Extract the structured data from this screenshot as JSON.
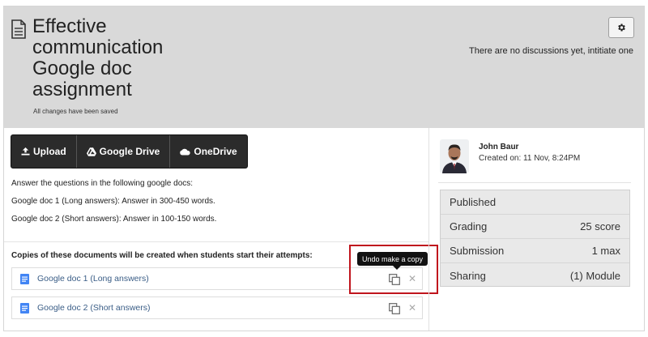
{
  "header": {
    "title": "Effective communication Google doc assignment",
    "saved_status": "All changes have been saved",
    "discussion_text": "There are no discussions yet, intitiate one"
  },
  "upload_buttons": [
    {
      "label": "Upload",
      "icon": "upload-icon"
    },
    {
      "label": "Google Drive",
      "icon": "google-drive-icon"
    },
    {
      "label": "OneDrive",
      "icon": "onedrive-icon"
    }
  ],
  "instructions": [
    "Answer the questions in the following google docs:",
    "Google doc 1 (Long answers): Answer in 300-450 words.",
    "Google doc 2 (Short answers): Answer in 100-150 words."
  ],
  "copies_label": "Copies of these documents will be created when students start their attempts:",
  "documents": [
    {
      "name": "Google doc 1 (Long answers)"
    },
    {
      "name": "Google doc 2 (Short answers)"
    }
  ],
  "tooltip": "Undo make a copy",
  "author": {
    "name": "John Baur",
    "created": "Created on: 11 Nov, 8:24PM"
  },
  "properties": [
    {
      "label": "Published",
      "value": ""
    },
    {
      "label": "Grading",
      "value": "25 score"
    },
    {
      "label": "Submission",
      "value": "1 max"
    },
    {
      "label": "Sharing",
      "value": "(1) Module"
    }
  ],
  "colors": {
    "header_bg": "#d9d9d9",
    "button_bg": "#2b2b2b",
    "link": "#3a5d86",
    "highlight": "#c0151d",
    "gdoc_blue": "#4285f4"
  }
}
